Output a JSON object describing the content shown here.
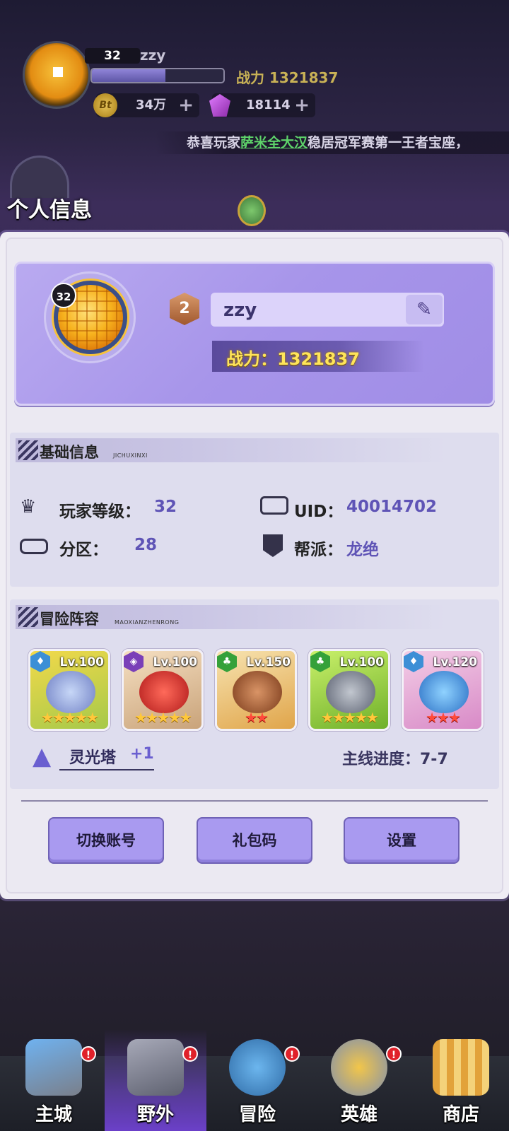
{
  "hud": {
    "level": "32",
    "name": "zzy",
    "xp_progress": 0.56,
    "power": "战力 1321837",
    "coins": "34万",
    "coin_symbol": "Bt",
    "gems": "18114",
    "plus": "+",
    "ticker_prefix": "恭喜玩家",
    "ticker_name": "萨米全大汉",
    "ticker_suffix": "稳居冠军赛第一王者宝座，"
  },
  "screen_title": "个人信息",
  "profile": {
    "level": "32",
    "rank": "2",
    "name": "zzy",
    "edit_icon": "pencil-icon",
    "power": "战力：1321837"
  },
  "basic_info": {
    "title": "基础信息",
    "subtitle": "JICHUXINXI",
    "player_level_label": "玩家等级：",
    "player_level": "32",
    "uid_label": "UID：",
    "uid": "40014702",
    "zone_label": "分区：",
    "zone": "28",
    "guild_label": "帮派：",
    "guild": "龙绝"
  },
  "lineup": {
    "title": "冒险阵容",
    "subtitle": "MAOXIANZHENRONG",
    "heroes": [
      {
        "level": "Lv.100",
        "stars": "★★★★★",
        "star_color": "gold",
        "type_icon": "water-drop-icon",
        "type_color": "#3c8fd6"
      },
      {
        "level": "Lv.100",
        "stars": "★★★★★",
        "star_color": "gold",
        "type_icon": "arcane-eye-icon",
        "type_color": "#7a3fb8"
      },
      {
        "level": "Lv.150",
        "stars": "★★",
        "star_color": "red",
        "type_icon": "leaf-icon",
        "type_color": "#35a13a"
      },
      {
        "level": "Lv.100",
        "stars": "★★★★★",
        "star_color": "gold",
        "type_icon": "leaf-icon",
        "type_color": "#35a13a"
      },
      {
        "level": "Lv.120",
        "stars": "★★★",
        "star_color": "red",
        "type_icon": "water-drop-icon",
        "type_color": "#3c8fd6"
      }
    ],
    "tower_label": "灵光塔",
    "tower_value": "+1",
    "stage_label": "主线进度：7-7"
  },
  "buttons": {
    "switch_account": "切换账号",
    "gift_code": "礼包码",
    "settings": "设置"
  },
  "nav": [
    {
      "label": "主城",
      "badge": "!"
    },
    {
      "label": "野外",
      "badge": "!"
    },
    {
      "label": "冒险",
      "badge": "!"
    },
    {
      "label": "英雄",
      "badge": "!"
    },
    {
      "label": "商店",
      "badge": ""
    }
  ],
  "colors": {
    "accent_purple": "#a99af0",
    "value_purple": "#5f54b6",
    "power_yellow": "#ffe55a",
    "ticker_green": "#5ed36a"
  }
}
